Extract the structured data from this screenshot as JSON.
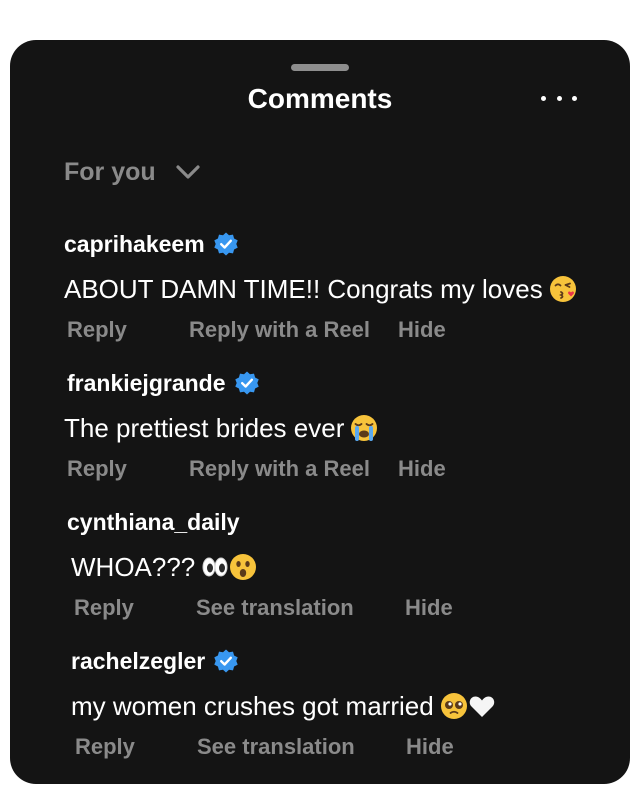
{
  "header": {
    "title": "Comments",
    "more_icon": "more-horizontal-icon"
  },
  "filter": {
    "label": "For you",
    "icon": "chevron-down-icon"
  },
  "comments": [
    {
      "username": "caprihakeem",
      "verified": true,
      "text": "ABOUT DAMN TIME!! Congrats my loves",
      "emojis": [
        "face-blowing-kiss"
      ],
      "actions": [
        "Reply",
        "Reply with a Reel",
        "Hide"
      ]
    },
    {
      "username": "frankiejgrande",
      "verified": true,
      "text": "The prettiest brides ever",
      "emojis": [
        "loudly-crying-face"
      ],
      "actions": [
        "Reply",
        "Reply with a Reel",
        "Hide"
      ]
    },
    {
      "username": "cynthiana_daily",
      "verified": false,
      "text": "WHOA???",
      "emojis": [
        "eyes",
        "astonished-face"
      ],
      "actions": [
        "Reply",
        "See translation",
        "Hide"
      ]
    },
    {
      "username": "rachelzegler",
      "verified": true,
      "text": "my women crushes got married",
      "emojis": [
        "pleading-face",
        "white-heart"
      ],
      "actions": [
        "Reply",
        "See translation",
        "Hide"
      ]
    }
  ],
  "colors": {
    "sheet_background": "#141414",
    "primary_text": "#ffffff",
    "secondary_text": "#8a8a8a",
    "verified_badge": "#3897f0"
  }
}
